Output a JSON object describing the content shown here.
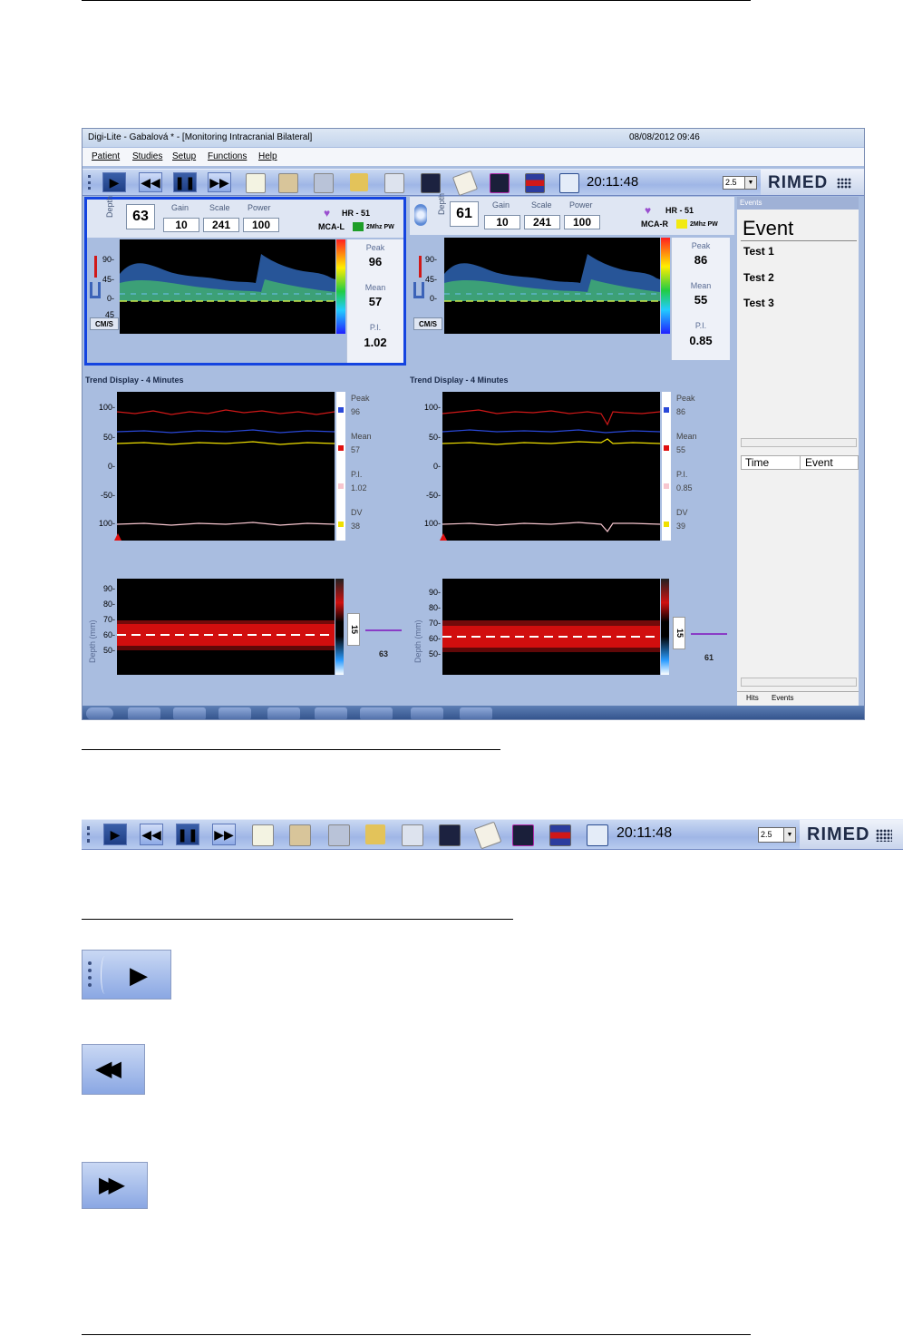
{
  "window": {
    "title": "Digi-Lite - Gabalová * - [Monitoring Intracranial Bilateral]",
    "datetime": "08/08/2012 09:46"
  },
  "menu": [
    "Patient",
    "Studies",
    "Setup",
    "Functions",
    "Help"
  ],
  "toolbar": {
    "clock": "20:11:48",
    "speed_value": "2.5",
    "brand": "RIMED",
    "icons": [
      "grip-icon",
      "play-icon",
      "rewind-icon",
      "pause-icon",
      "fast-forward-icon",
      "report-icon",
      "patient-icon",
      "save-icon",
      "folder-open-icon",
      "print-icon",
      "layout-icon",
      "notes-icon",
      "add-chart-icon",
      "color-bars-icon",
      "monitor-icon"
    ]
  },
  "left_probe": {
    "depth_label": "Depth",
    "depth": "63",
    "gain_label": "Gain",
    "gain": "10",
    "scale_label": "Scale",
    "scale": "241",
    "power_label": "Power",
    "power": "100",
    "hr": "HR - 51",
    "vessel": "MCA-L",
    "mode": "2Mhz PW",
    "mode_color": "#1e9e28",
    "peak_label": "Peak",
    "peak": "96",
    "mean_label": "Mean",
    "mean": "57",
    "pi_label": "P.I.",
    "pi": "1.02",
    "units": "CM/S",
    "axis": [
      "90-",
      "45-",
      "0-",
      "45"
    ]
  },
  "right_probe": {
    "depth_label": "Depth",
    "depth": "61",
    "gain_label": "Gain",
    "gain": "10",
    "scale_label": "Scale",
    "scale": "241",
    "power_label": "Power",
    "power": "100",
    "hr": "HR - 51",
    "vessel": "MCA-R",
    "mode": "2Mhz PW",
    "mode_color": "#f2ea10",
    "peak_label": "Peak",
    "peak": "86",
    "mean_label": "Mean",
    "mean": "55",
    "pi_label": "P.I.",
    "pi": "0.85",
    "units": "CM/S",
    "axis": [
      "90-",
      "45-",
      "0-"
    ]
  },
  "trend_left": {
    "title": "Trend Display - 4 Minutes",
    "yticks": [
      "100-",
      "50-",
      "0-",
      "-50-",
      "100-"
    ],
    "legend": [
      {
        "label": "Peak",
        "value": "96",
        "color": "#2a48d8"
      },
      {
        "label": "Mean",
        "value": "57",
        "color": "#e01010"
      },
      {
        "label": "P.I.",
        "value": "1.02",
        "color": "#f7c6cf"
      },
      {
        "label": "DV",
        "value": "38",
        "color": "#f0e000"
      }
    ],
    "depth_axis_label": "Depth (mm)",
    "depth_ticks": [
      "90-",
      "80-",
      "70-",
      "60-",
      "50-"
    ],
    "gate": "15",
    "depth_value": "63"
  },
  "trend_right": {
    "title": "Trend Display - 4 Minutes",
    "yticks": [
      "100-",
      "50-",
      "0-",
      "-50-",
      "100-"
    ],
    "legend": [
      {
        "label": "Peak",
        "value": "86",
        "color": "#2a48d8"
      },
      {
        "label": "Mean",
        "value": "55",
        "color": "#e01010"
      },
      {
        "label": "P.I.",
        "value": "0.85",
        "color": "#f7c6cf"
      },
      {
        "label": "DV",
        "value": "39",
        "color": "#f0e000"
      }
    ],
    "depth_axis_label": "Depth (mm)",
    "depth_ticks": [
      "90-",
      "80-",
      "70-",
      "60-",
      "50-"
    ],
    "gate": "15",
    "depth_value": "61"
  },
  "events": {
    "panel_title": "Events",
    "heading": "Event",
    "items": [
      "Test 1",
      "Test 2",
      "Test 3"
    ],
    "col_time": "Time",
    "col_event": "Event",
    "tab_hits": "Hits",
    "tab_events": "Events"
  },
  "toolbar_zoom": {
    "clock": "20:11:48",
    "speed_value": "2.5",
    "brand": "RIMED"
  }
}
